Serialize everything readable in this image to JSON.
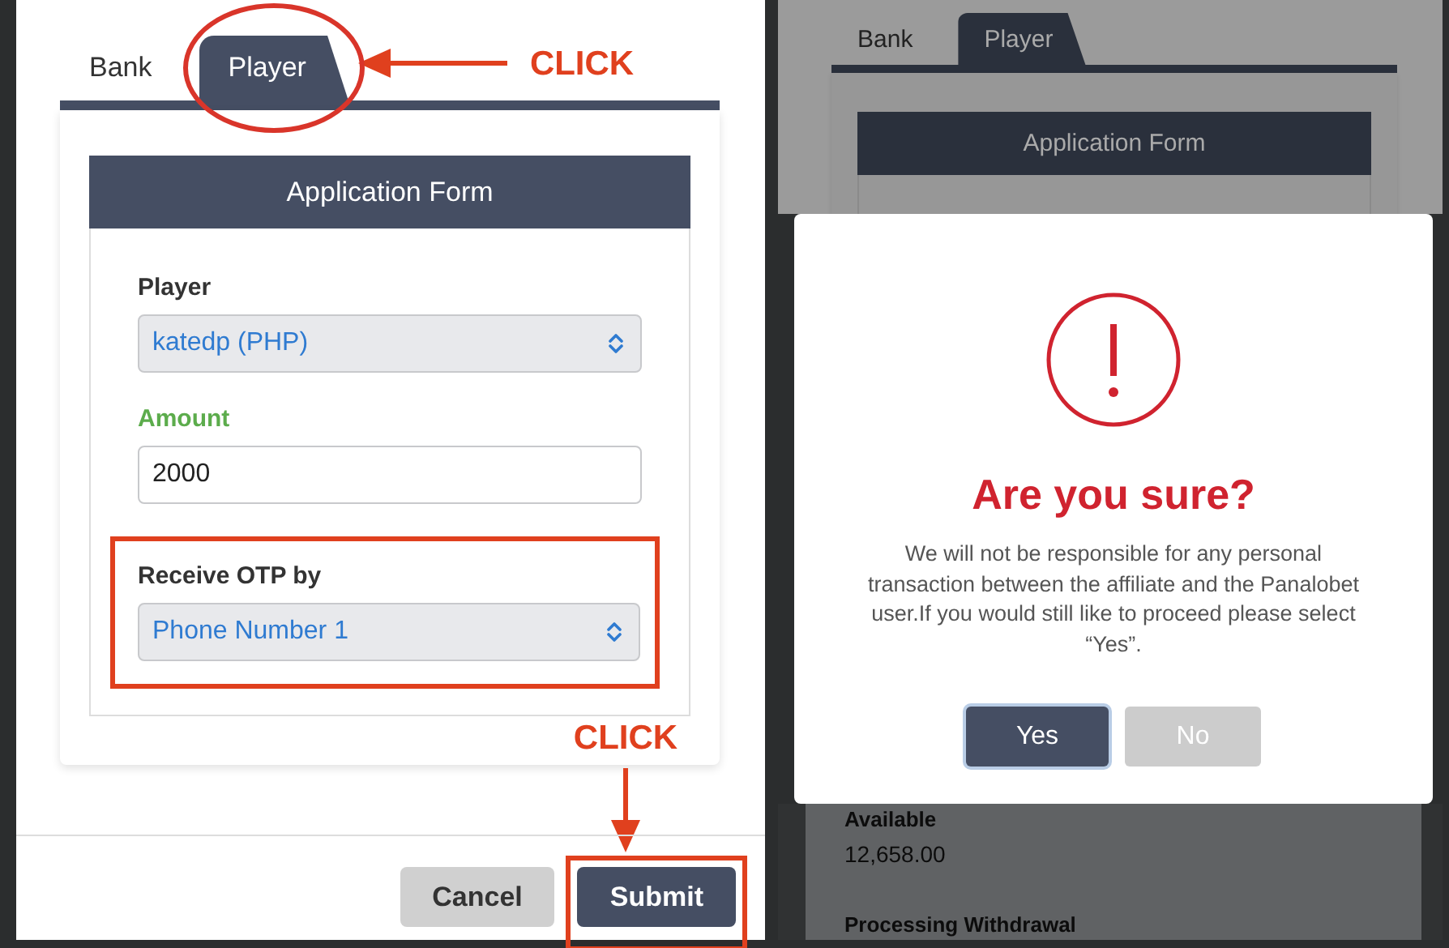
{
  "left_screen": {
    "tabs": [
      {
        "label": "Bank",
        "selected": false,
        "circled": false
      },
      {
        "label": "Player",
        "selected": true,
        "circled": true
      }
    ],
    "tab_callout": "CLICK",
    "form_title": "Application Form",
    "fields": [
      {
        "kind": "select",
        "label": "Player",
        "value": "katedp (PHP)",
        "valid": false,
        "highlighted": false
      },
      {
        "kind": "input",
        "label": "Amount",
        "value": "2000",
        "valid": true,
        "highlighted": false
      },
      {
        "kind": "select",
        "label": "Receive OTP by",
        "value": "Phone Number 1",
        "valid": false,
        "highlighted": true
      }
    ],
    "submit_callout": "CLICK",
    "buttons": [
      {
        "label": "Cancel",
        "kind": "secondary",
        "highlighted": false
      },
      {
        "label": "Submit",
        "kind": "primary",
        "highlighted": true
      }
    ]
  },
  "right_screen": {
    "tabs": [
      {
        "label": "Bank",
        "selected": false
      },
      {
        "label": "Player",
        "selected": true
      }
    ],
    "form_title": "Application Form",
    "dialog": {
      "title": "Are you sure?",
      "message": "We will not be responsible for any personal transaction between the affiliate and the Panalobet user.If you would still like to proceed please select “Yes”.",
      "buttons": [
        {
          "label": "Yes",
          "kind": "primary",
          "focused": true
        },
        {
          "label": "No",
          "kind": "disabled",
          "focused": false
        }
      ]
    },
    "background_fields": [
      {
        "label": "Available",
        "value": "12,658.00"
      },
      {
        "label": "Processing Withdrawal"
      }
    ]
  }
}
